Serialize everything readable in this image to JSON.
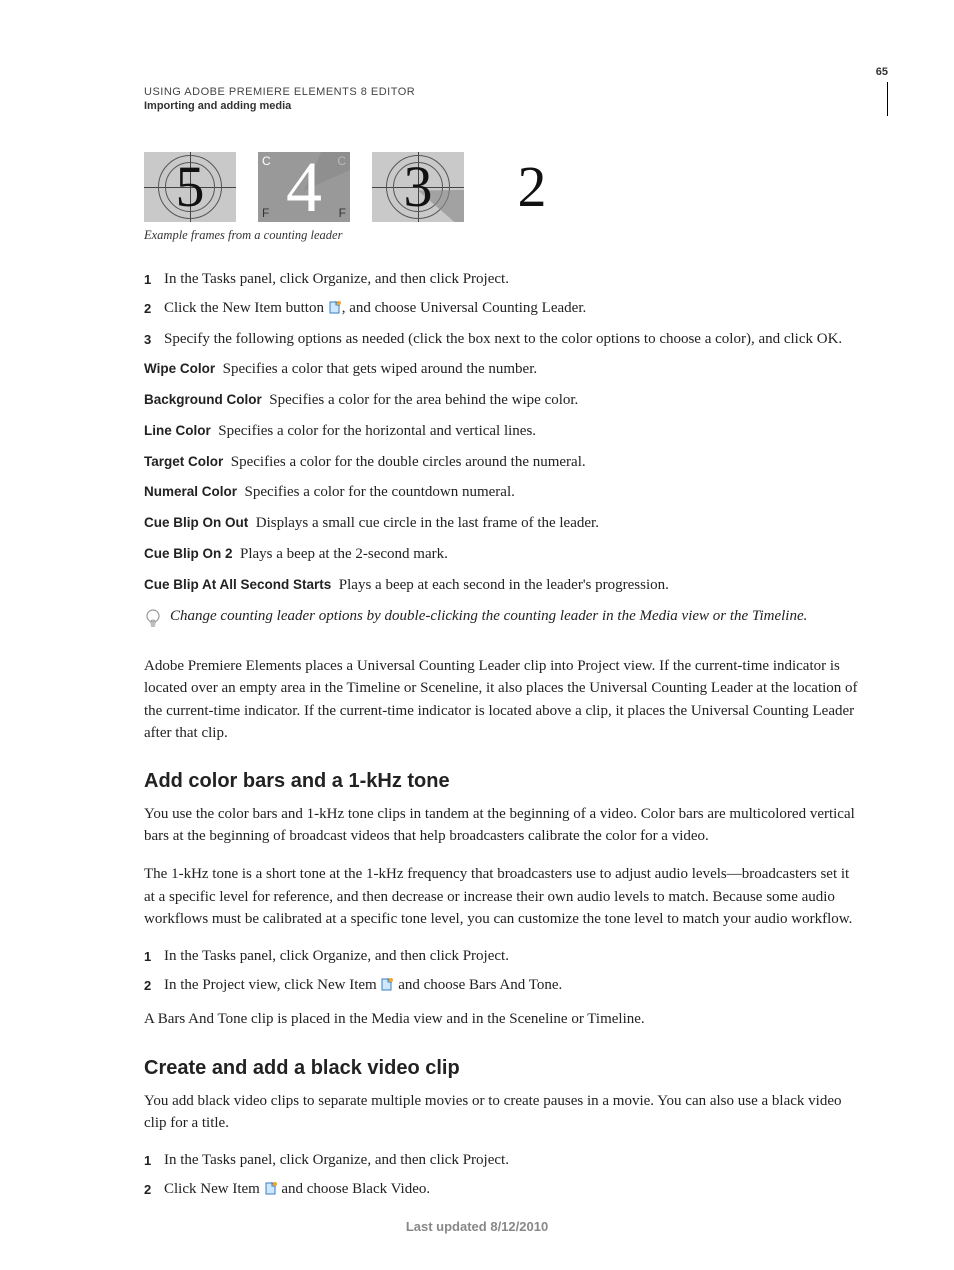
{
  "header": {
    "running_title": "USING ADOBE PREMIERE ELEMENTS 8 EDITOR",
    "running_sub": "Importing and adding media",
    "page_number": "65"
  },
  "frames_caption": "Example frames from a counting leader",
  "steps_a": [
    "In the Tasks panel, click Organize, and then click Project.",
    "Click the New Item button ",
    "Specify the following options as needed (click the box next to the color options to choose a color), and click OK."
  ],
  "step_a2_tail": ", and choose Universal Counting Leader.",
  "defs": [
    {
      "term": "Wipe Color",
      "desc": "Specifies a color that gets wiped around the number."
    },
    {
      "term": "Background Color",
      "desc": "Specifies a color for the area behind the wipe color."
    },
    {
      "term": "Line Color",
      "desc": "Specifies a color for the horizontal and vertical lines."
    },
    {
      "term": "Target Color",
      "desc": "Specifies a color for the double circles around the numeral."
    },
    {
      "term": "Numeral Color",
      "desc": "Specifies a color for the countdown numeral."
    },
    {
      "term": "Cue Blip On Out",
      "desc": "Displays a small cue circle in the last frame of the leader."
    },
    {
      "term": "Cue Blip On 2",
      "desc": "Plays a beep at the 2-second mark."
    },
    {
      "term": "Cue Blip At All Second Starts",
      "desc": "Plays a beep at each second in the leader's progression."
    }
  ],
  "tip_text": "Change counting leader options by double-clicking the counting leader in the Media view or the Timeline.",
  "para_after_tip": "Adobe Premiere Elements places a Universal Counting Leader clip into Project view. If the current-time indicator is located over an empty area in the Timeline or Sceneline, it also places the Universal Counting Leader at the location of the current-time indicator. If the current-time indicator is located above a clip, it places the Universal Counting Leader after that clip.",
  "section_b": {
    "title": "Add color bars and a 1-kHz tone",
    "p1": "You use the color bars and 1-kHz tone clips in tandem at the beginning of a video. Color bars are multicolored vertical bars at the beginning of broadcast videos that help broadcasters calibrate the color for a video.",
    "p2": "The 1-kHz tone is a short tone at the 1-kHz frequency that broadcasters use to adjust audio levels—broadcasters set it at a specific level for reference, and then decrease or increase their own audio levels to match. Because some audio workflows must be calibrated at a specific tone level, you can customize the tone level to match your audio workflow.",
    "steps": [
      "In the Tasks panel, click Organize, and then click Project.",
      "In the Project view, click New Item "
    ],
    "step2_tail": " and choose Bars And Tone.",
    "after": "A Bars And Tone clip is placed in the Media view and in the Sceneline or Timeline."
  },
  "section_c": {
    "title": "Create and add a black video clip",
    "p1": "You add black video clips to separate multiple movies or to create pauses in a movie. You can also use a black video clip for a title.",
    "steps": [
      "In the Tasks panel, click Organize, and then click Project.",
      "Click New Item "
    ],
    "step2_tail": " and choose Black Video."
  },
  "footer": "Last updated 8/12/2010"
}
